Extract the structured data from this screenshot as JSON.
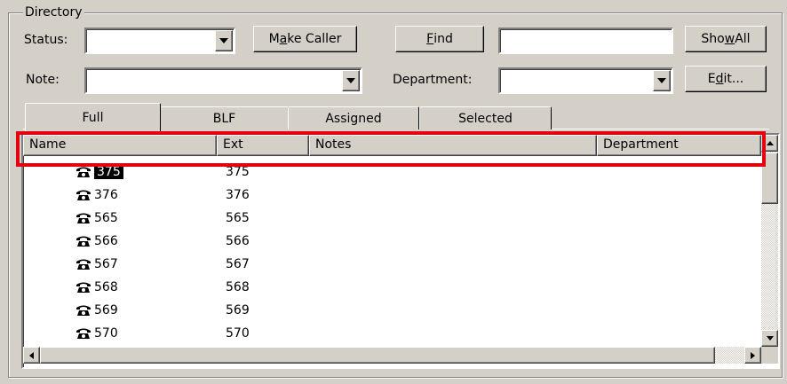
{
  "window": {
    "group_title": "Directory"
  },
  "filters": {
    "status_label": "Status:",
    "status_value": "",
    "note_label": "Note:",
    "note_value": "",
    "department_label": "Department:",
    "department_value": "",
    "find_value": ""
  },
  "buttons": {
    "make_caller": "Make Caller",
    "find": "Find",
    "show_all": "Show All",
    "edit": "Edit..."
  },
  "tabs": [
    {
      "label": "Full",
      "active": true
    },
    {
      "label": "BLF",
      "active": false
    },
    {
      "label": "Assigned",
      "active": false
    },
    {
      "label": "Selected",
      "active": false
    }
  ],
  "columns": [
    "Name",
    "Ext",
    "Notes",
    "Department"
  ],
  "rows": [
    {
      "name": "375",
      "ext": "375",
      "selected": true
    },
    {
      "name": "376",
      "ext": "376"
    },
    {
      "name": "565",
      "ext": "565"
    },
    {
      "name": "566",
      "ext": "566"
    },
    {
      "name": "567",
      "ext": "567"
    },
    {
      "name": "568",
      "ext": "568"
    },
    {
      "name": "569",
      "ext": "569"
    },
    {
      "name": "570",
      "ext": "570"
    }
  ],
  "colors": {
    "highlight": "#e3000f",
    "face": "#d4d0c8"
  }
}
